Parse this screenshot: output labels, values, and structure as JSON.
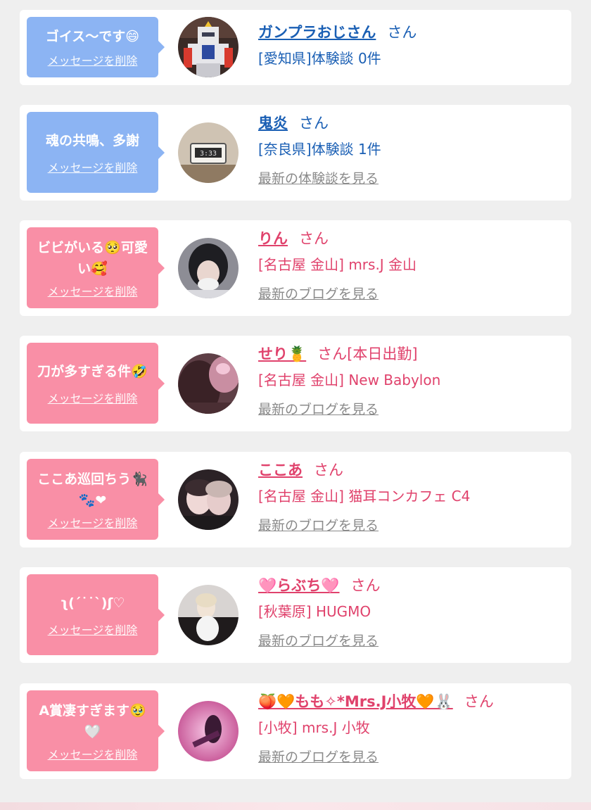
{
  "common": {
    "delete_label": "メッセージを削除",
    "san": "さん"
  },
  "entries": [
    {
      "gender": "m",
      "message": "ゴイス〜です😄",
      "name": "ガンプラおじさん",
      "name_suffix": "",
      "shop": "[愛知県]体験談 0件",
      "latest": "",
      "avatar": "gundam-avatar"
    },
    {
      "gender": "m",
      "message": "魂の共鳴、多謝",
      "name": "鬼炎",
      "name_suffix": "",
      "shop": "[奈良県]体験談 1件",
      "latest": "最新の体験談を見る",
      "avatar": "clock-avatar"
    },
    {
      "gender": "f",
      "message": "ビビがいる🥺可愛い🥰",
      "name": "りん",
      "name_suffix": "",
      "shop": "[名古屋 金山] mrs.J 金山",
      "latest": "最新のブログを見る",
      "avatar": "girl-photo-avatar"
    },
    {
      "gender": "f",
      "message": "刀が多すぎる件🤣",
      "name": "せり🍍",
      "name_suffix": "[本日出勤]",
      "shop": "[名古屋 金山] New Babylon",
      "latest": "最新のブログを見る",
      "avatar": "girl-photo-avatar"
    },
    {
      "gender": "f",
      "message": "ここあ巡回ちう🐈‍⬛🐾❤",
      "name": "ここあ",
      "name_suffix": "",
      "shop": "[名古屋 金山] 猫耳コンカフェ C4",
      "latest": "最新のブログを見る",
      "avatar": "girl-photo-avatar"
    },
    {
      "gender": "f",
      "message": "ʅ(ˊ˙˙ˋ)ʃ♡",
      "name": "🩷らぶち🩷",
      "name_suffix": "",
      "shop": "[秋葉原] HUGMO",
      "latest": "最新のブログを見る",
      "avatar": "girl-photo-avatar"
    },
    {
      "gender": "f",
      "message": "A賞凄すぎます🥹🤍",
      "name": "🍑🧡もも✧*Mrs.J小牧🧡🐰",
      "name_suffix": "",
      "shop": "[小牧] mrs.J 小牧",
      "latest": "最新のブログを見る",
      "avatar": "girl-photo-avatar"
    }
  ],
  "colors": {
    "male_bubble": "#8cb4f3",
    "female_bubble": "#f98fa6",
    "male_text": "#1a5fb4",
    "female_text": "#e0426c",
    "link_gray": "#8a8a8a"
  }
}
